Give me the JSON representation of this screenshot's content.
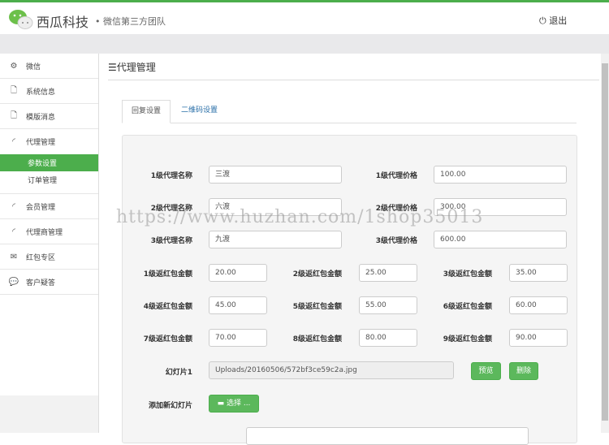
{
  "header": {
    "brand": "西瓜科技",
    "slogan": "• 微信第三方团队",
    "logout": "退出"
  },
  "sidebar": {
    "items": [
      {
        "icon": "gears-icon",
        "label": "微信"
      },
      {
        "icon": "file-icon",
        "label": "系统信息"
      },
      {
        "icon": "file-icon",
        "label": "模版消息"
      },
      {
        "icon": "rss-icon",
        "label": "代理管理"
      }
    ],
    "sub": [
      {
        "label": "参数设置",
        "active": true
      },
      {
        "label": "订单管理"
      }
    ],
    "items2": [
      {
        "icon": "rss-icon",
        "label": "会员管理"
      },
      {
        "icon": "rss-icon",
        "label": "代理商管理"
      },
      {
        "icon": "envelope-icon",
        "label": "红包专区"
      },
      {
        "icon": "comments-icon",
        "label": "客户疑答"
      }
    ]
  },
  "page": {
    "title": "代理管理",
    "tabs": [
      "回复设置",
      "二维码设置"
    ]
  },
  "form": {
    "names": [
      {
        "label": "1级代理名称",
        "value": "三渡"
      },
      {
        "label": "2级代理名称",
        "value": "六渡"
      },
      {
        "label": "3级代理名称",
        "value": "九渡"
      }
    ],
    "prices": [
      {
        "label": "1级代理价格",
        "value": "100.00"
      },
      {
        "label": "2级代理价格",
        "value": "300.00"
      },
      {
        "label": "3级代理价格",
        "value": "600.00"
      }
    ],
    "rebates": [
      {
        "label": "1级返红包金额",
        "value": "20.00"
      },
      {
        "label": "2级返红包金额",
        "value": "25.00"
      },
      {
        "label": "3级返红包金额",
        "value": "35.00"
      },
      {
        "label": "4级返红包金额",
        "value": "45.00"
      },
      {
        "label": "5级返红包金额",
        "value": "55.00"
      },
      {
        "label": "6级返红包金额",
        "value": "60.00"
      },
      {
        "label": "7级返红包金额",
        "value": "70.00"
      },
      {
        "label": "8级返红包金额",
        "value": "80.00"
      },
      {
        "label": "9级返红包金额",
        "value": "90.00"
      }
    ],
    "slide_label": "幻灯片1",
    "slide_value": "Uploads/20160506/572bf3ce59c2a.jpg",
    "preview": "预览",
    "delete": "删除",
    "add_label": "添加新幻灯片",
    "choose": "选择 ..."
  },
  "watermark": "https://www.huzhan.com/1shop35013",
  "colors": {
    "accent": "#4cae4c"
  }
}
